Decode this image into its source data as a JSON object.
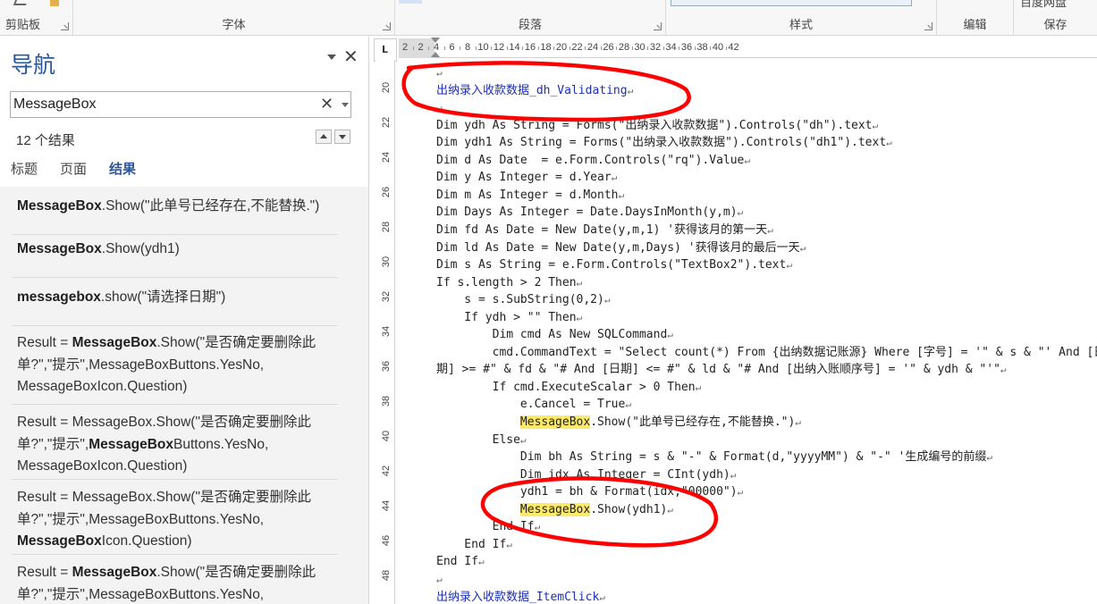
{
  "ribbon": {
    "groups": [
      {
        "name": "剪贴板"
      },
      {
        "name": "字体"
      },
      {
        "name": "段落"
      },
      {
        "name": "样式"
      },
      {
        "name": "编辑"
      },
      {
        "name": "保存"
      }
    ],
    "partial_label": "百度网盘"
  },
  "nav": {
    "title": "导航",
    "search_value": "MessageBox",
    "result_count": "12 个结果",
    "tabs": [
      "标题",
      "页面",
      "结果"
    ],
    "active_tab": "结果",
    "results": [
      {
        "parts": [
          {
            "t": "MessageBox",
            "b": true
          },
          {
            "t": ".Show(\"此单号已经存在,不能替换.\")",
            "b": false
          }
        ]
      },
      {
        "parts": [
          {
            "t": "MessageBox",
            "b": true
          },
          {
            "t": ".Show(ydh1)",
            "b": false
          }
        ]
      },
      {
        "parts": [
          {
            "t": "messagebox",
            "b": true
          },
          {
            "t": ".show(\"请选择日期\")",
            "b": false
          }
        ]
      },
      {
        "parts": [
          {
            "t": "Result = ",
            "b": false
          },
          {
            "t": "MessageBox",
            "b": true
          },
          {
            "t": ".Show(\"是否确定要删除此单?\",\"提示\",MessageBoxButtons.YesNo, MessageBoxIcon.Question)",
            "b": false
          }
        ]
      },
      {
        "parts": [
          {
            "t": "Result = MessageBox.Show(\"是否确定要删除此单?\",\"提示\",",
            "b": false
          },
          {
            "t": "MessageBox",
            "b": true
          },
          {
            "t": "Buttons.YesNo, MessageBoxIcon.Question)",
            "b": false
          }
        ]
      },
      {
        "parts": [
          {
            "t": "Result = MessageBox.Show(\"是否确定要删除此单?\",\"提示\",MessageBoxButtons.YesNo, ",
            "b": false
          },
          {
            "t": "MessageBox",
            "b": true
          },
          {
            "t": "Icon.Question)",
            "b": false
          }
        ]
      },
      {
        "parts": [
          {
            "t": "Result = ",
            "b": false
          },
          {
            "t": "MessageBox",
            "b": true
          },
          {
            "t": ".Show(\"是否确定要删除此单?\",\"提示\",MessageBoxButtons.YesNo,",
            "b": false
          }
        ]
      }
    ]
  },
  "ruler": {
    "corner": "L",
    "h_numbers": [
      "2",
      "2",
      "4",
      "6",
      "8",
      "10",
      "12",
      "14",
      "16",
      "18",
      "20",
      "22",
      "24",
      "26",
      "28",
      "30",
      "32",
      "34",
      "36",
      "38",
      "40",
      "42"
    ],
    "v_numbers": [
      "20",
      "22",
      "24",
      "26",
      "28",
      "30",
      "32",
      "34",
      "36",
      "38",
      "40",
      "42",
      "44",
      "46",
      "48"
    ]
  },
  "document": {
    "lines": [
      {
        "text": "",
        "kind": "blank"
      },
      {
        "text": "出纳录入收款数据_dh_Validating",
        "kind": "proc"
      },
      {
        "text": "",
        "kind": "blank"
      },
      {
        "text": "Dim ydh As String = Forms(\"出纳录入收款数据\").Controls(\"dh\").text",
        "kind": "code"
      },
      {
        "text": "Dim ydh1 As String = Forms(\"出纳录入收款数据\").Controls(\"dh1\").text",
        "kind": "code"
      },
      {
        "text": "Dim d As Date  = e.Form.Controls(\"rq\").Value",
        "kind": "code"
      },
      {
        "text": "Dim y As Integer = d.Year",
        "kind": "code"
      },
      {
        "text": "Dim m As Integer = d.Month",
        "kind": "code"
      },
      {
        "text": "Dim Days As Integer = Date.DaysInMonth(y,m)",
        "kind": "code"
      },
      {
        "text": "Dim fd As Date = New Date(y,m,1) '获得该月的第一天",
        "kind": "code"
      },
      {
        "text": "Dim ld As Date = New Date(y,m,Days) '获得该月的最后一天",
        "kind": "code"
      },
      {
        "text": "Dim s As String = e.Form.Controls(\"TextBox2\").text",
        "kind": "code"
      },
      {
        "text": "If s.length > 2 Then",
        "kind": "code"
      },
      {
        "text": "    s = s.SubString(0,2)",
        "kind": "code"
      },
      {
        "text": "    If ydh > \"\" Then",
        "kind": "code"
      },
      {
        "text": "        Dim cmd As New SQLCommand",
        "kind": "code"
      },
      {
        "text": "        cmd.CommandText = \"Select count(*) From {出纳数据记账源} Where [字号] = '\" & s & \"' And [日",
        "kind": "code"
      },
      {
        "text": "期] >= #\" & fd & \"# And [日期] <= #\" & ld & \"# And [出纳入账顺序号] = '\" & ydh & \"'\"",
        "kind": "code"
      },
      {
        "text": "        If cmd.ExecuteScalar > 0 Then",
        "kind": "code"
      },
      {
        "text": "            e.Cancel = True",
        "kind": "code"
      },
      {
        "text": "            MessageBox.Show(\"此单号已经存在,不能替换.\")",
        "kind": "code",
        "highlight": "MessageBox"
      },
      {
        "text": "        Else",
        "kind": "code"
      },
      {
        "text": "            Dim bh As String = s & \"-\" & Format(d,\"yyyyMM\") & \"-\" '生成编号的前缀",
        "kind": "code"
      },
      {
        "text": "            Dim idx As Integer = CInt(ydh)",
        "kind": "code"
      },
      {
        "text": "            ydh1 = bh & Format(idx,\"00000\")",
        "kind": "code"
      },
      {
        "text": "            MessageBox.Show(ydh1)",
        "kind": "code",
        "highlight": "MessageBox"
      },
      {
        "text": "        End If",
        "kind": "code"
      },
      {
        "text": "    End If",
        "kind": "code"
      },
      {
        "text": "End If",
        "kind": "code"
      },
      {
        "text": "",
        "kind": "blank"
      },
      {
        "text": "出纳录入收款数据_ItemClick",
        "kind": "proc"
      }
    ],
    "annotation_color": "#ff0000",
    "highlight_color": "#fde96a",
    "proc_color": "#1c2fb6"
  }
}
